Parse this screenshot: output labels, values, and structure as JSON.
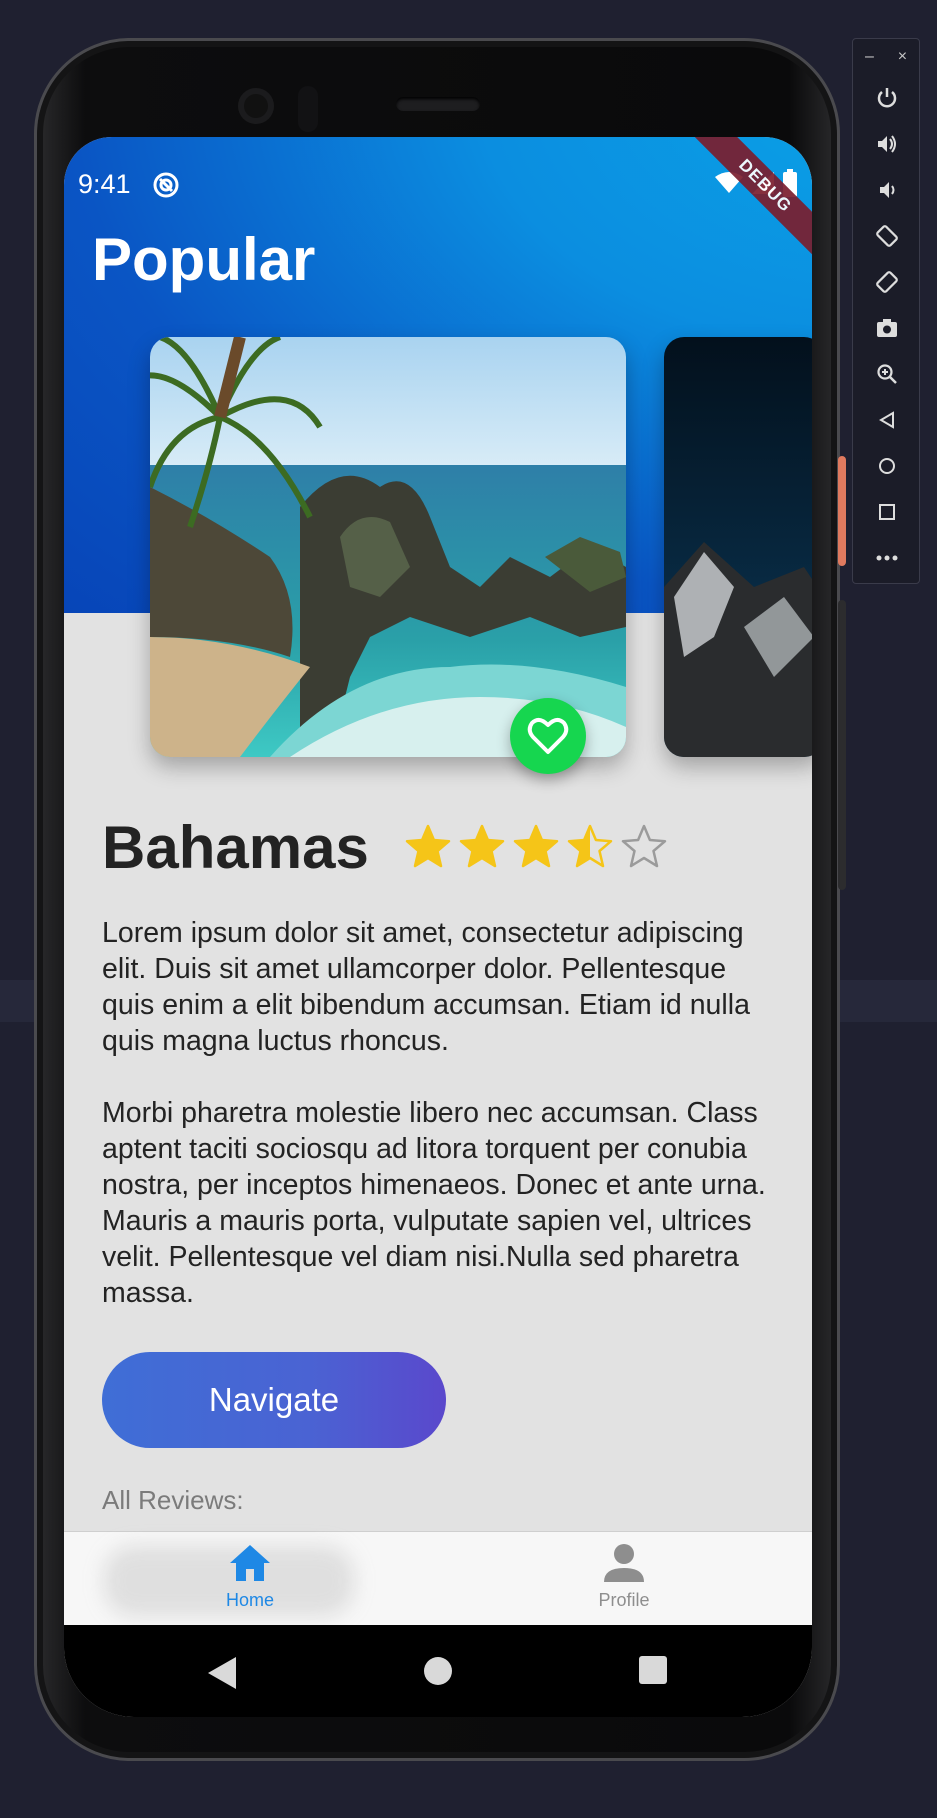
{
  "status_bar": {
    "time": "9:41",
    "debug_label": "DEBUG"
  },
  "header": {
    "title": "Popular"
  },
  "destination": {
    "name": "Bahamas",
    "rating": 3.5,
    "rating_max": 5,
    "description": [
      "Lorem ipsum dolor sit amet, consectetur adipiscing elit. Duis sit amet ullamcorper dolor. Pellentesque quis enim a elit bibendum accumsan. Etiam id nulla quis magna luctus rhoncus.",
      "Morbi pharetra molestie libero nec accumsan. Class aptent taciti sociosqu ad litora torquent per conubia nostra, per inceptos himenaeos. Donec et ante urna. Mauris a mauris porta, vulputate sapien vel, ultrices velit. Pellentesque vel diam nisi.Nulla sed pharetra massa."
    ],
    "navigate_label": "Navigate",
    "reviews_label": "All Reviews:"
  },
  "bottom_nav": {
    "items": [
      {
        "label": "Home",
        "icon": "home-icon",
        "active": true
      },
      {
        "label": "Profile",
        "icon": "person-icon",
        "active": false
      }
    ]
  },
  "emulator_toolbar": {
    "window_controls": [
      "–",
      "×"
    ],
    "buttons": [
      "power-icon",
      "volume-up-icon",
      "volume-down-icon",
      "rotate-left-icon",
      "rotate-right-icon",
      "camera-icon",
      "zoom-icon",
      "back-icon",
      "home-circle-icon",
      "overview-icon",
      "more-icon"
    ]
  },
  "colors": {
    "header_blue": "#0a55c4",
    "favorite_green": "#16d64f",
    "star_gold": "#f5c518",
    "active_nav": "#1e88e5"
  }
}
